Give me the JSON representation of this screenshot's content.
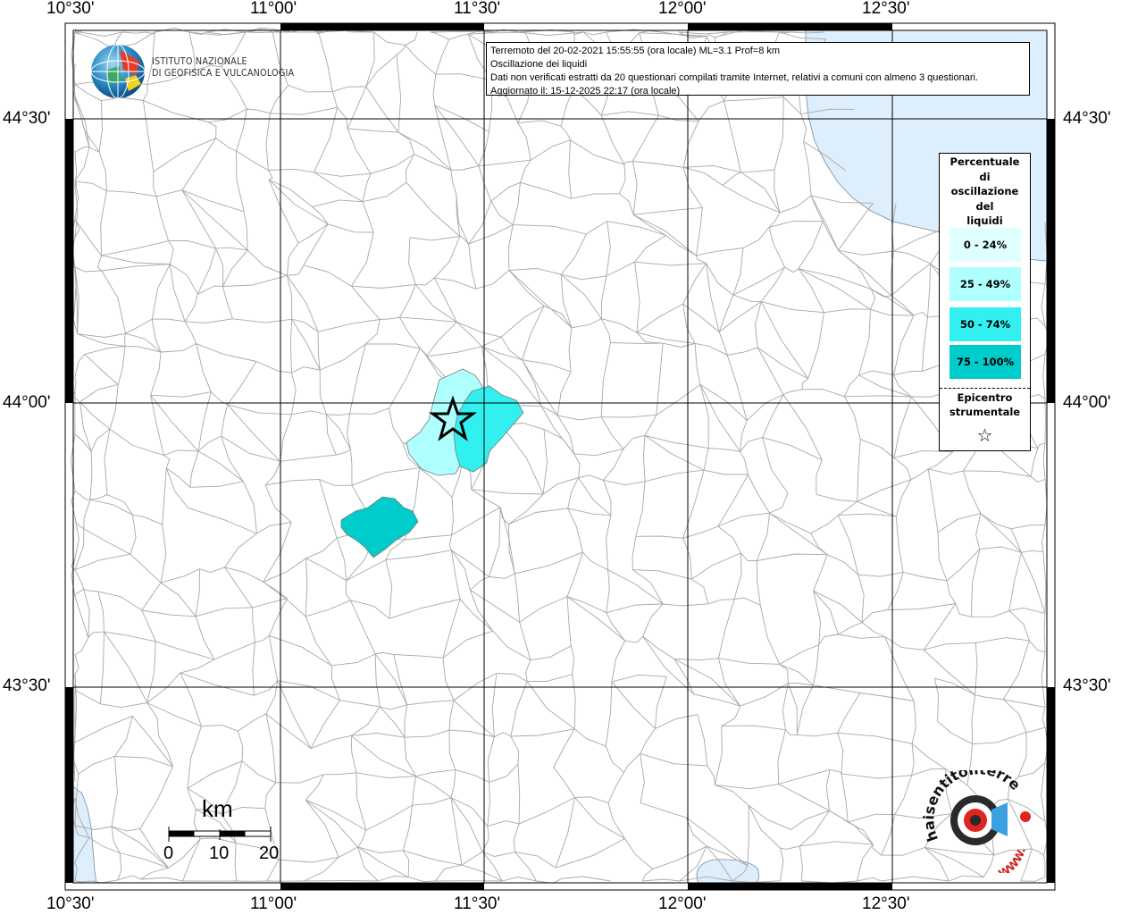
{
  "axes": {
    "longitude_labels": [
      "10°30'",
      "11°00'",
      "11°30'",
      "12°00'",
      "12°30'"
    ],
    "latitude_labels": [
      "44°30'",
      "44°00'",
      "43°30'"
    ]
  },
  "info": {
    "line1": "Terremoto del 20-02-2021 15:55:55 (ora locale) ML=3.1 Prof=8 km",
    "line2": "Oscillazione dei liquidi",
    "line3": "Dati non verificati estratti da 20 questionari compilati tramite Internet, relativi a comuni con almeno 3 questionari.",
    "line4": "Aggiornato il: 15-12-2025 22:17 (ora locale)"
  },
  "logo": {
    "line1": "ISTITUTO NAZIONALE",
    "line2": "DI GEOFISICA E VULCANOLOGIA"
  },
  "legend": {
    "title_lines": [
      "Percentuale",
      "di",
      "oscillazione",
      "del",
      "liquidi"
    ],
    "items": [
      {
        "label": "0 - 24%",
        "color": "#e0ffff"
      },
      {
        "label": "25 - 49%",
        "color": "#b0ffff"
      },
      {
        "label": "50 - 74%",
        "color": "#33f0f0"
      },
      {
        "label": "75 - 100%",
        "color": "#00cccc"
      }
    ],
    "epicenter_line1": "Epicentro",
    "epicenter_line2": "strumentale",
    "epicenter_symbol": "☆"
  },
  "scale": {
    "unit": "km",
    "ticks": [
      "0",
      "10",
      "20"
    ]
  },
  "watermark": {
    "text": "haisentitoilterremoto.it",
    "url_text": "WWW."
  },
  "colors": {
    "sea": "#ddeefc",
    "border": "#9a9a9a",
    "grid": "#000000"
  }
}
